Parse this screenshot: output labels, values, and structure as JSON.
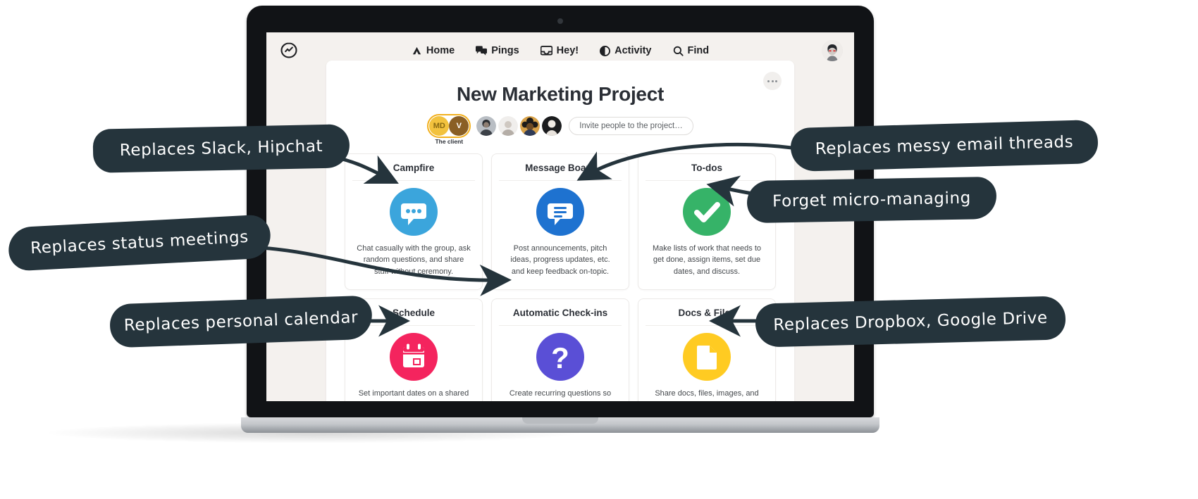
{
  "app": {
    "logo_icon": "basecamp-logo-icon",
    "nav": [
      {
        "label": "Home",
        "icon": "home-icon"
      },
      {
        "label": "Pings",
        "icon": "chat-bubbles-icon"
      },
      {
        "label": "Hey!",
        "icon": "inbox-tray-icon"
      },
      {
        "label": "Activity",
        "icon": "half-circle-icon"
      },
      {
        "label": "Find",
        "icon": "search-icon"
      }
    ],
    "account_avatar": "user-avatar"
  },
  "project": {
    "title": "New Marketing Project",
    "kebab_label": "More options",
    "client_badge_label": "The client",
    "people": [
      {
        "type": "initials",
        "initials": "MD",
        "client": true
      },
      {
        "type": "initials",
        "initials": "V",
        "client": true
      },
      {
        "type": "photo",
        "id": "person-1"
      },
      {
        "type": "photo",
        "id": "person-2"
      },
      {
        "type": "photo",
        "id": "person-3"
      },
      {
        "type": "photo",
        "id": "person-4"
      }
    ],
    "invite_placeholder": "Invite people to the project…"
  },
  "tools": [
    {
      "title": "Campfire",
      "icon": "speech-bubble-dots-icon",
      "color": "#3BA5DC",
      "desc": "Chat casually with the group, ask random questions, and share stuff without ceremony."
    },
    {
      "title": "Message Board",
      "icon": "message-lines-icon",
      "color": "#1E72D0",
      "desc": "Post announcements, pitch ideas, progress updates, etc. and keep feedback on-topic."
    },
    {
      "title": "To-dos",
      "icon": "check-circle-icon",
      "color": "#36B368",
      "desc": "Make lists of work that needs to get done, assign items, set due dates, and discuss."
    },
    {
      "title": "Schedule",
      "icon": "calendar-icon",
      "color": "#F4245E",
      "desc": "Set important dates on a shared schedule. Subscribe to events in Google Cal, iCal, or Outlook."
    },
    {
      "title": "Automatic Check-ins",
      "icon": "question-mark-circle-icon",
      "color": "#5A4FD6",
      "desc": "Create recurring questions so you don't have to pester your team about what's going on."
    },
    {
      "title": "Docs & Files",
      "icon": "document-page-icon",
      "color": "#FFCB22",
      "desc": "Share docs, files, images, and spreadsheets. Organize in folders so they're easy to find."
    }
  ],
  "annotations": [
    {
      "id": "ann-slack",
      "text": "Replaces Slack, Hipchat"
    },
    {
      "id": "ann-email",
      "text": "Replaces messy email threads"
    },
    {
      "id": "ann-micro",
      "text": "Forget micro-managing"
    },
    {
      "id": "ann-status",
      "text": "Replaces status meetings"
    },
    {
      "id": "ann-calendar",
      "text": "Replaces personal calendar"
    },
    {
      "id": "ann-dropbox",
      "text": "Replaces Dropbox, Google Drive"
    }
  ],
  "colors": {
    "annotation_bg": "#25343c",
    "screen_bg": "#f4f1ee",
    "client_ring": "#f2b01e"
  }
}
